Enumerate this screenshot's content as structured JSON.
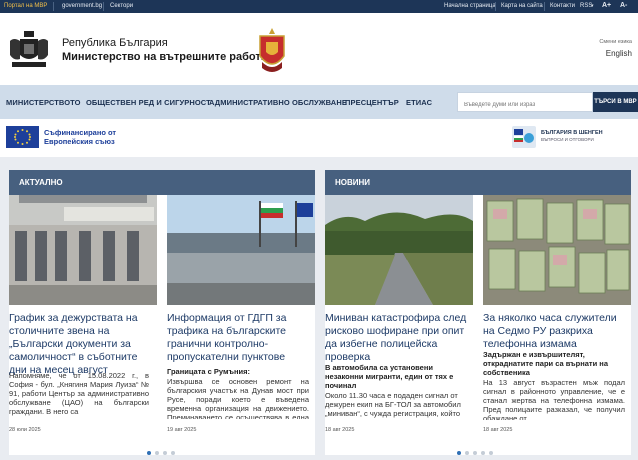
{
  "topbar": {
    "portal": "Портал на МВР",
    "gov": "government.bg",
    "sectors": "Сектори",
    "home": "Начална страница",
    "sitemap": "Карта на сайта",
    "contacts": "Контакти",
    "rss": "RSS",
    "font_plus": "A+",
    "font_minus": "A-"
  },
  "header": {
    "republic": "Република България",
    "ministry": "Министерство на вътрешните работи",
    "lang_label": "Смени езика",
    "lang": "English"
  },
  "nav": {
    "items": [
      "МИНИСТЕРСТВОТО",
      "ОБЩЕСТВЕН РЕД И СИГУРНОСТ",
      "АДМИНИСТРАТИВНО ОБСЛУЖВАНЕ",
      "ПРЕСЦЕНТЪР",
      "ЕТИАС"
    ],
    "search_placeholder": "Въведете думи или израз",
    "search_button": "ТЪРСИ В МВР"
  },
  "band": {
    "eu_text": "Съфинансирано от Европейския съюз",
    "schengen_title": "БЪЛГАРИЯ В ШЕНГЕН",
    "schengen_sub": "ВЪПРОСИ И ОТГОВОРИ"
  },
  "actual": {
    "heading": "АКТУАЛНО",
    "cards": [
      {
        "title": "График за дежурствата на столичните звена на „Български документи за самоличност“ в съботните дни на месец август",
        "body": "Напомняме, че от 15.08.2022 г., в София - бул. „Княгиня Мария Луиза“ № 91, работи Център за административно обслужване (ЦАО) на български граждани. В него са",
        "date": "28 юли 2025"
      },
      {
        "title": "Информация от ГДГП за трафика на българските гранични контролно-пропускателни пунктове",
        "subtitle": "Границата с Румъния:",
        "body": "Извършва се основен ремонт на българския участък на Дунав мост при Русе, поради което е въведена временна организация на движението. Преминаването се осъществява в една лента с",
        "date": "19 авг 2025"
      }
    ]
  },
  "news": {
    "heading": "НОВИНИ",
    "cards": [
      {
        "title": "Миниван катастрофира след рисково шофиране при опит да избегне полицейска проверка",
        "subtitle": "В автомобила са установени незаконни мигранти, един от тях е починал",
        "body": "Около 11.30 часа е подаден сигнал от дежурен екип на БГ-ТОЛ за автомобил „миниван“, с чужда регистрация, който",
        "date": "18 авг 2025"
      },
      {
        "title": "За няколко часа служители на Седмо РУ разкриха телефонна измама",
        "subtitle": "Задържан е извършителят, откраднатите пари са върнати на собственика",
        "body": "На 13 август възрастен мъж подал сигнал в районното управление, че е станал жертва на телефонна измама. Пред полицаите разказал, че получил обаждане от",
        "date": "18 авг 2025"
      }
    ]
  },
  "colors": {
    "topbar": "#1d3557",
    "nav": "#cfdcea",
    "panel_header": "#47607f",
    "title": "#1d3a66",
    "accent_dot": "#2f6fb5"
  }
}
